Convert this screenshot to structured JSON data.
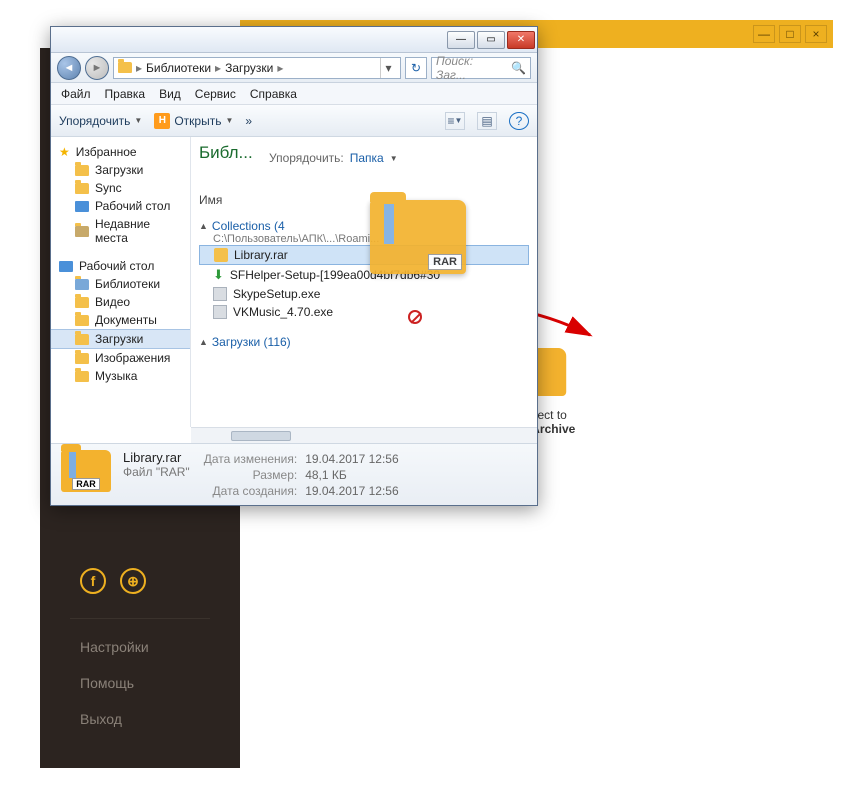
{
  "bg": {
    "win_min": "—",
    "win_max": "□",
    "win_close": "×",
    "drop_line1": "or Select to",
    "drop_line2": "Open Archive",
    "links": {
      "settings": "Настройки",
      "help": "Помощь",
      "exit": "Выход"
    }
  },
  "explorer": {
    "win_min": "—",
    "win_max": "▭",
    "win_close": "✕",
    "nav_back": "◄",
    "nav_fwd": "►",
    "crumbs": {
      "root": "Библиотеки",
      "sep": "▸",
      "sub": "Загрузки"
    },
    "addr_drop": "▾",
    "refresh": "↻",
    "search_placeholder": "Поиск: Заг...",
    "menu": {
      "file": "Файл",
      "edit": "Правка",
      "view": "Вид",
      "tools": "Сервис",
      "help": "Справка"
    },
    "toolbar": {
      "organize": "Упорядочить",
      "open": "Открыть",
      "more": "»",
      "views": "≡",
      "preview": "▤",
      "help": "?"
    },
    "lib_label": "Библ...",
    "arrange_label": "Упорядочить:",
    "arrange_value": "Папка",
    "col_name": "Имя",
    "groups": {
      "collections": {
        "label": "Collections (4",
        "path": "C:\\Пользователь\\АПК\\...\\Roami..."
      },
      "downloads": {
        "label": "Загрузки (116)"
      }
    },
    "files": {
      "f0": "Library.rar",
      "f1": "SFHelper-Setup-[199ea00d4bf7db6#30",
      "f2": "SkypeSetup.exe",
      "f3": "VKMusic_4.70.exe"
    },
    "drag_label": "RAR",
    "nav": {
      "fav": "Избранное",
      "downloads": "Загрузки",
      "sync": "Sync",
      "desktop": "Рабочий стол",
      "recent": "Недавние места",
      "desktop2": "Рабочий стол",
      "libs": "Библиотеки",
      "video": "Видео",
      "docs": "Документы",
      "downloads2": "Загрузки",
      "images": "Изображения",
      "music": "Музыка"
    },
    "details": {
      "filename": "Library.rar",
      "filetype": "Файл \"RAR\"",
      "rar": "RAR",
      "m_date_k": "Дата изменения:",
      "m_date_v": "19.04.2017 12:56",
      "size_k": "Размер:",
      "size_v": "48,1 КБ",
      "c_date_k": "Дата создания:",
      "c_date_v": "19.04.2017 12:56"
    }
  }
}
